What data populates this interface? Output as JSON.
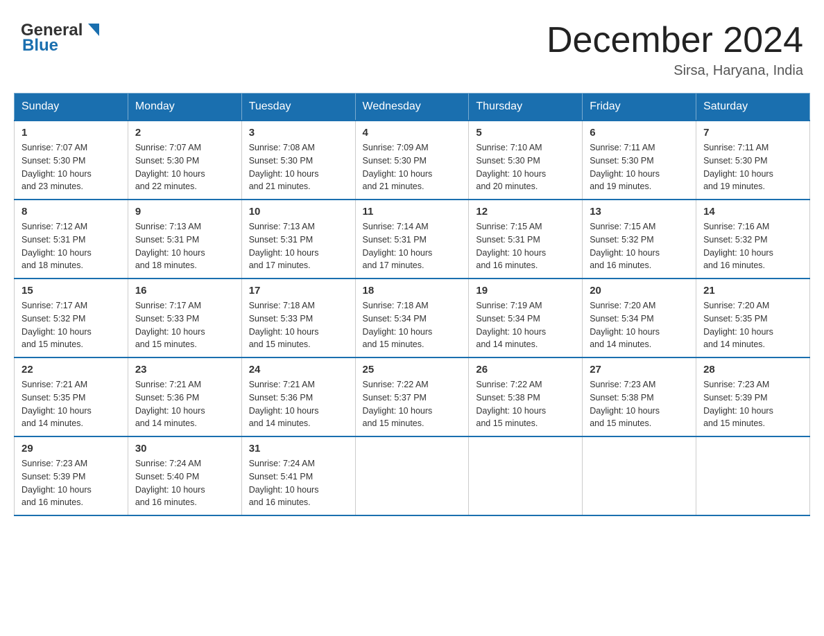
{
  "header": {
    "logo_general": "General",
    "logo_blue": "Blue",
    "month_title": "December 2024",
    "subtitle": "Sirsa, Haryana, India"
  },
  "weekdays": [
    "Sunday",
    "Monday",
    "Tuesday",
    "Wednesday",
    "Thursday",
    "Friday",
    "Saturday"
  ],
  "weeks": [
    [
      {
        "day": "1",
        "sunrise": "7:07 AM",
        "sunset": "5:30 PM",
        "daylight": "10 hours and 23 minutes."
      },
      {
        "day": "2",
        "sunrise": "7:07 AM",
        "sunset": "5:30 PM",
        "daylight": "10 hours and 22 minutes."
      },
      {
        "day": "3",
        "sunrise": "7:08 AM",
        "sunset": "5:30 PM",
        "daylight": "10 hours and 21 minutes."
      },
      {
        "day": "4",
        "sunrise": "7:09 AM",
        "sunset": "5:30 PM",
        "daylight": "10 hours and 21 minutes."
      },
      {
        "day": "5",
        "sunrise": "7:10 AM",
        "sunset": "5:30 PM",
        "daylight": "10 hours and 20 minutes."
      },
      {
        "day": "6",
        "sunrise": "7:11 AM",
        "sunset": "5:30 PM",
        "daylight": "10 hours and 19 minutes."
      },
      {
        "day": "7",
        "sunrise": "7:11 AM",
        "sunset": "5:30 PM",
        "daylight": "10 hours and 19 minutes."
      }
    ],
    [
      {
        "day": "8",
        "sunrise": "7:12 AM",
        "sunset": "5:31 PM",
        "daylight": "10 hours and 18 minutes."
      },
      {
        "day": "9",
        "sunrise": "7:13 AM",
        "sunset": "5:31 PM",
        "daylight": "10 hours and 18 minutes."
      },
      {
        "day": "10",
        "sunrise": "7:13 AM",
        "sunset": "5:31 PM",
        "daylight": "10 hours and 17 minutes."
      },
      {
        "day": "11",
        "sunrise": "7:14 AM",
        "sunset": "5:31 PM",
        "daylight": "10 hours and 17 minutes."
      },
      {
        "day": "12",
        "sunrise": "7:15 AM",
        "sunset": "5:31 PM",
        "daylight": "10 hours and 16 minutes."
      },
      {
        "day": "13",
        "sunrise": "7:15 AM",
        "sunset": "5:32 PM",
        "daylight": "10 hours and 16 minutes."
      },
      {
        "day": "14",
        "sunrise": "7:16 AM",
        "sunset": "5:32 PM",
        "daylight": "10 hours and 16 minutes."
      }
    ],
    [
      {
        "day": "15",
        "sunrise": "7:17 AM",
        "sunset": "5:32 PM",
        "daylight": "10 hours and 15 minutes."
      },
      {
        "day": "16",
        "sunrise": "7:17 AM",
        "sunset": "5:33 PM",
        "daylight": "10 hours and 15 minutes."
      },
      {
        "day": "17",
        "sunrise": "7:18 AM",
        "sunset": "5:33 PM",
        "daylight": "10 hours and 15 minutes."
      },
      {
        "day": "18",
        "sunrise": "7:18 AM",
        "sunset": "5:34 PM",
        "daylight": "10 hours and 15 minutes."
      },
      {
        "day": "19",
        "sunrise": "7:19 AM",
        "sunset": "5:34 PM",
        "daylight": "10 hours and 14 minutes."
      },
      {
        "day": "20",
        "sunrise": "7:20 AM",
        "sunset": "5:34 PM",
        "daylight": "10 hours and 14 minutes."
      },
      {
        "day": "21",
        "sunrise": "7:20 AM",
        "sunset": "5:35 PM",
        "daylight": "10 hours and 14 minutes."
      }
    ],
    [
      {
        "day": "22",
        "sunrise": "7:21 AM",
        "sunset": "5:35 PM",
        "daylight": "10 hours and 14 minutes."
      },
      {
        "day": "23",
        "sunrise": "7:21 AM",
        "sunset": "5:36 PM",
        "daylight": "10 hours and 14 minutes."
      },
      {
        "day": "24",
        "sunrise": "7:21 AM",
        "sunset": "5:36 PM",
        "daylight": "10 hours and 14 minutes."
      },
      {
        "day": "25",
        "sunrise": "7:22 AM",
        "sunset": "5:37 PM",
        "daylight": "10 hours and 15 minutes."
      },
      {
        "day": "26",
        "sunrise": "7:22 AM",
        "sunset": "5:38 PM",
        "daylight": "10 hours and 15 minutes."
      },
      {
        "day": "27",
        "sunrise": "7:23 AM",
        "sunset": "5:38 PM",
        "daylight": "10 hours and 15 minutes."
      },
      {
        "day": "28",
        "sunrise": "7:23 AM",
        "sunset": "5:39 PM",
        "daylight": "10 hours and 15 minutes."
      }
    ],
    [
      {
        "day": "29",
        "sunrise": "7:23 AM",
        "sunset": "5:39 PM",
        "daylight": "10 hours and 16 minutes."
      },
      {
        "day": "30",
        "sunrise": "7:24 AM",
        "sunset": "5:40 PM",
        "daylight": "10 hours and 16 minutes."
      },
      {
        "day": "31",
        "sunrise": "7:24 AM",
        "sunset": "5:41 PM",
        "daylight": "10 hours and 16 minutes."
      },
      null,
      null,
      null,
      null
    ]
  ],
  "labels": {
    "sunrise": "Sunrise: ",
    "sunset": "Sunset: ",
    "daylight": "Daylight: "
  }
}
